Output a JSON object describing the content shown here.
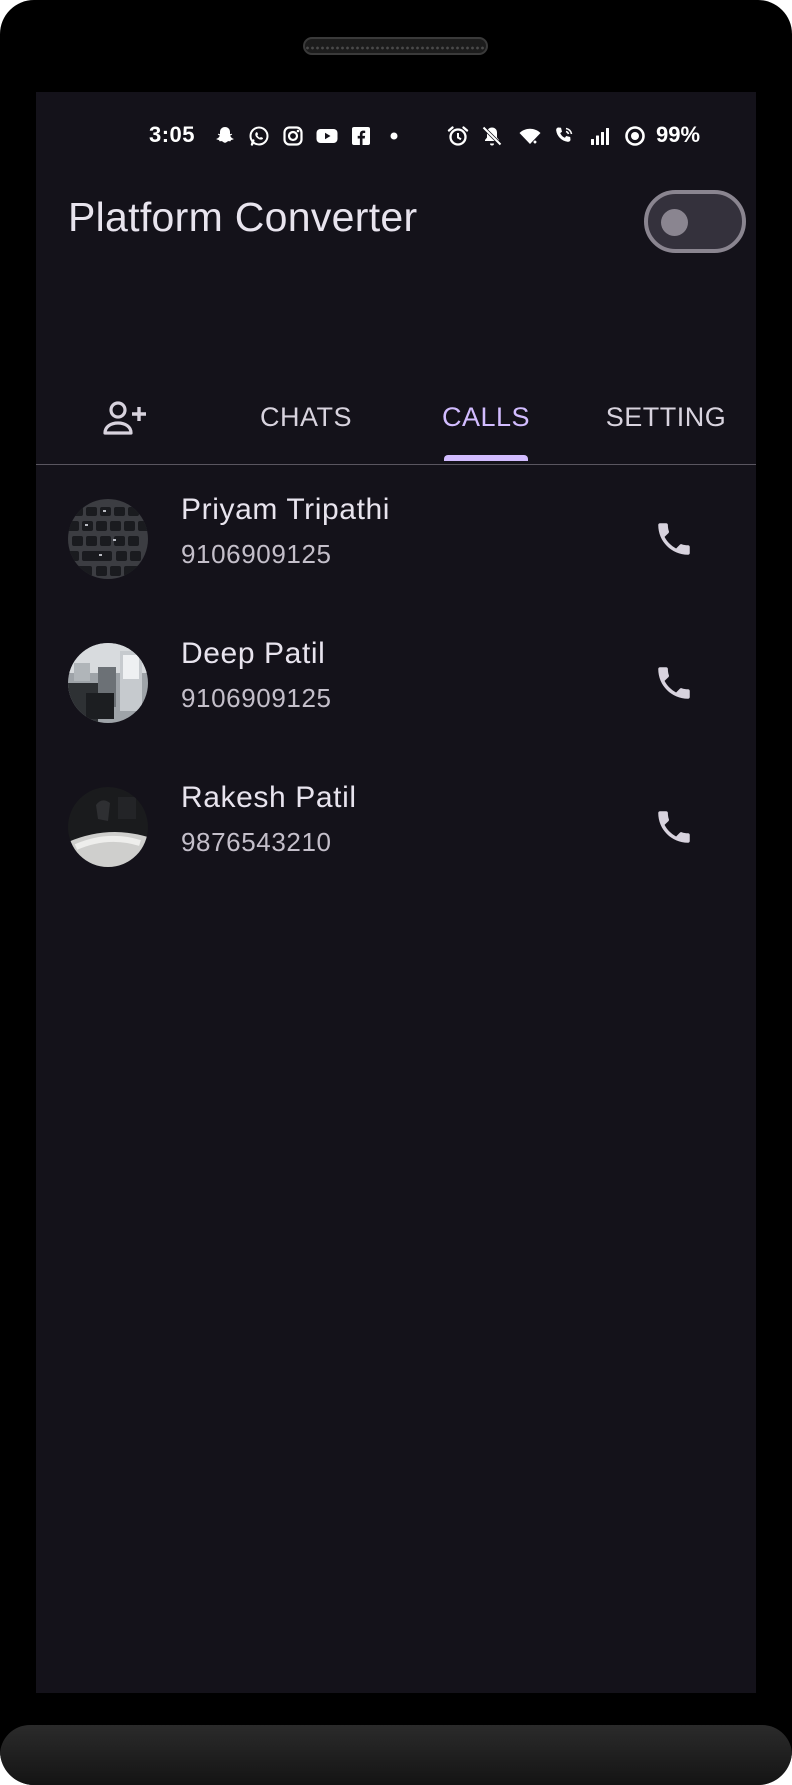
{
  "status_bar": {
    "time": "3:05",
    "battery": "99%",
    "left_icons": [
      "snapchat-icon",
      "whatsapp-icon",
      "instagram-icon",
      "youtube-icon",
      "facebook-icon",
      "dot-icon"
    ],
    "right_icons": [
      "alarm-icon",
      "vibrate-off-icon",
      "wifi-icon",
      "wifi-calling-icon",
      "signal-icon",
      "data-saver-icon"
    ]
  },
  "app_bar": {
    "title": "Platform Converter",
    "theme_toggle_on": false
  },
  "tabs": [
    {
      "label": "",
      "icon": "add-person-icon",
      "active": false
    },
    {
      "label": "CHATS",
      "active": false
    },
    {
      "label": "CALLS",
      "active": true
    },
    {
      "label": "SETTING",
      "active": false
    }
  ],
  "calls": [
    {
      "name": "Priyam Tripathi",
      "phone": "9106909125",
      "avatar": "keyboard-photo"
    },
    {
      "name": "Deep Patil",
      "phone": "9106909125",
      "avatar": "room-photo"
    },
    {
      "name": "Rakesh Patil",
      "phone": "9876543210",
      "avatar": "dark-photo"
    }
  ],
  "colors": {
    "background": "#14121a",
    "accent": "#d2bcff",
    "text_primary": "#e8e4ee",
    "text_secondary": "#c4bfca"
  }
}
